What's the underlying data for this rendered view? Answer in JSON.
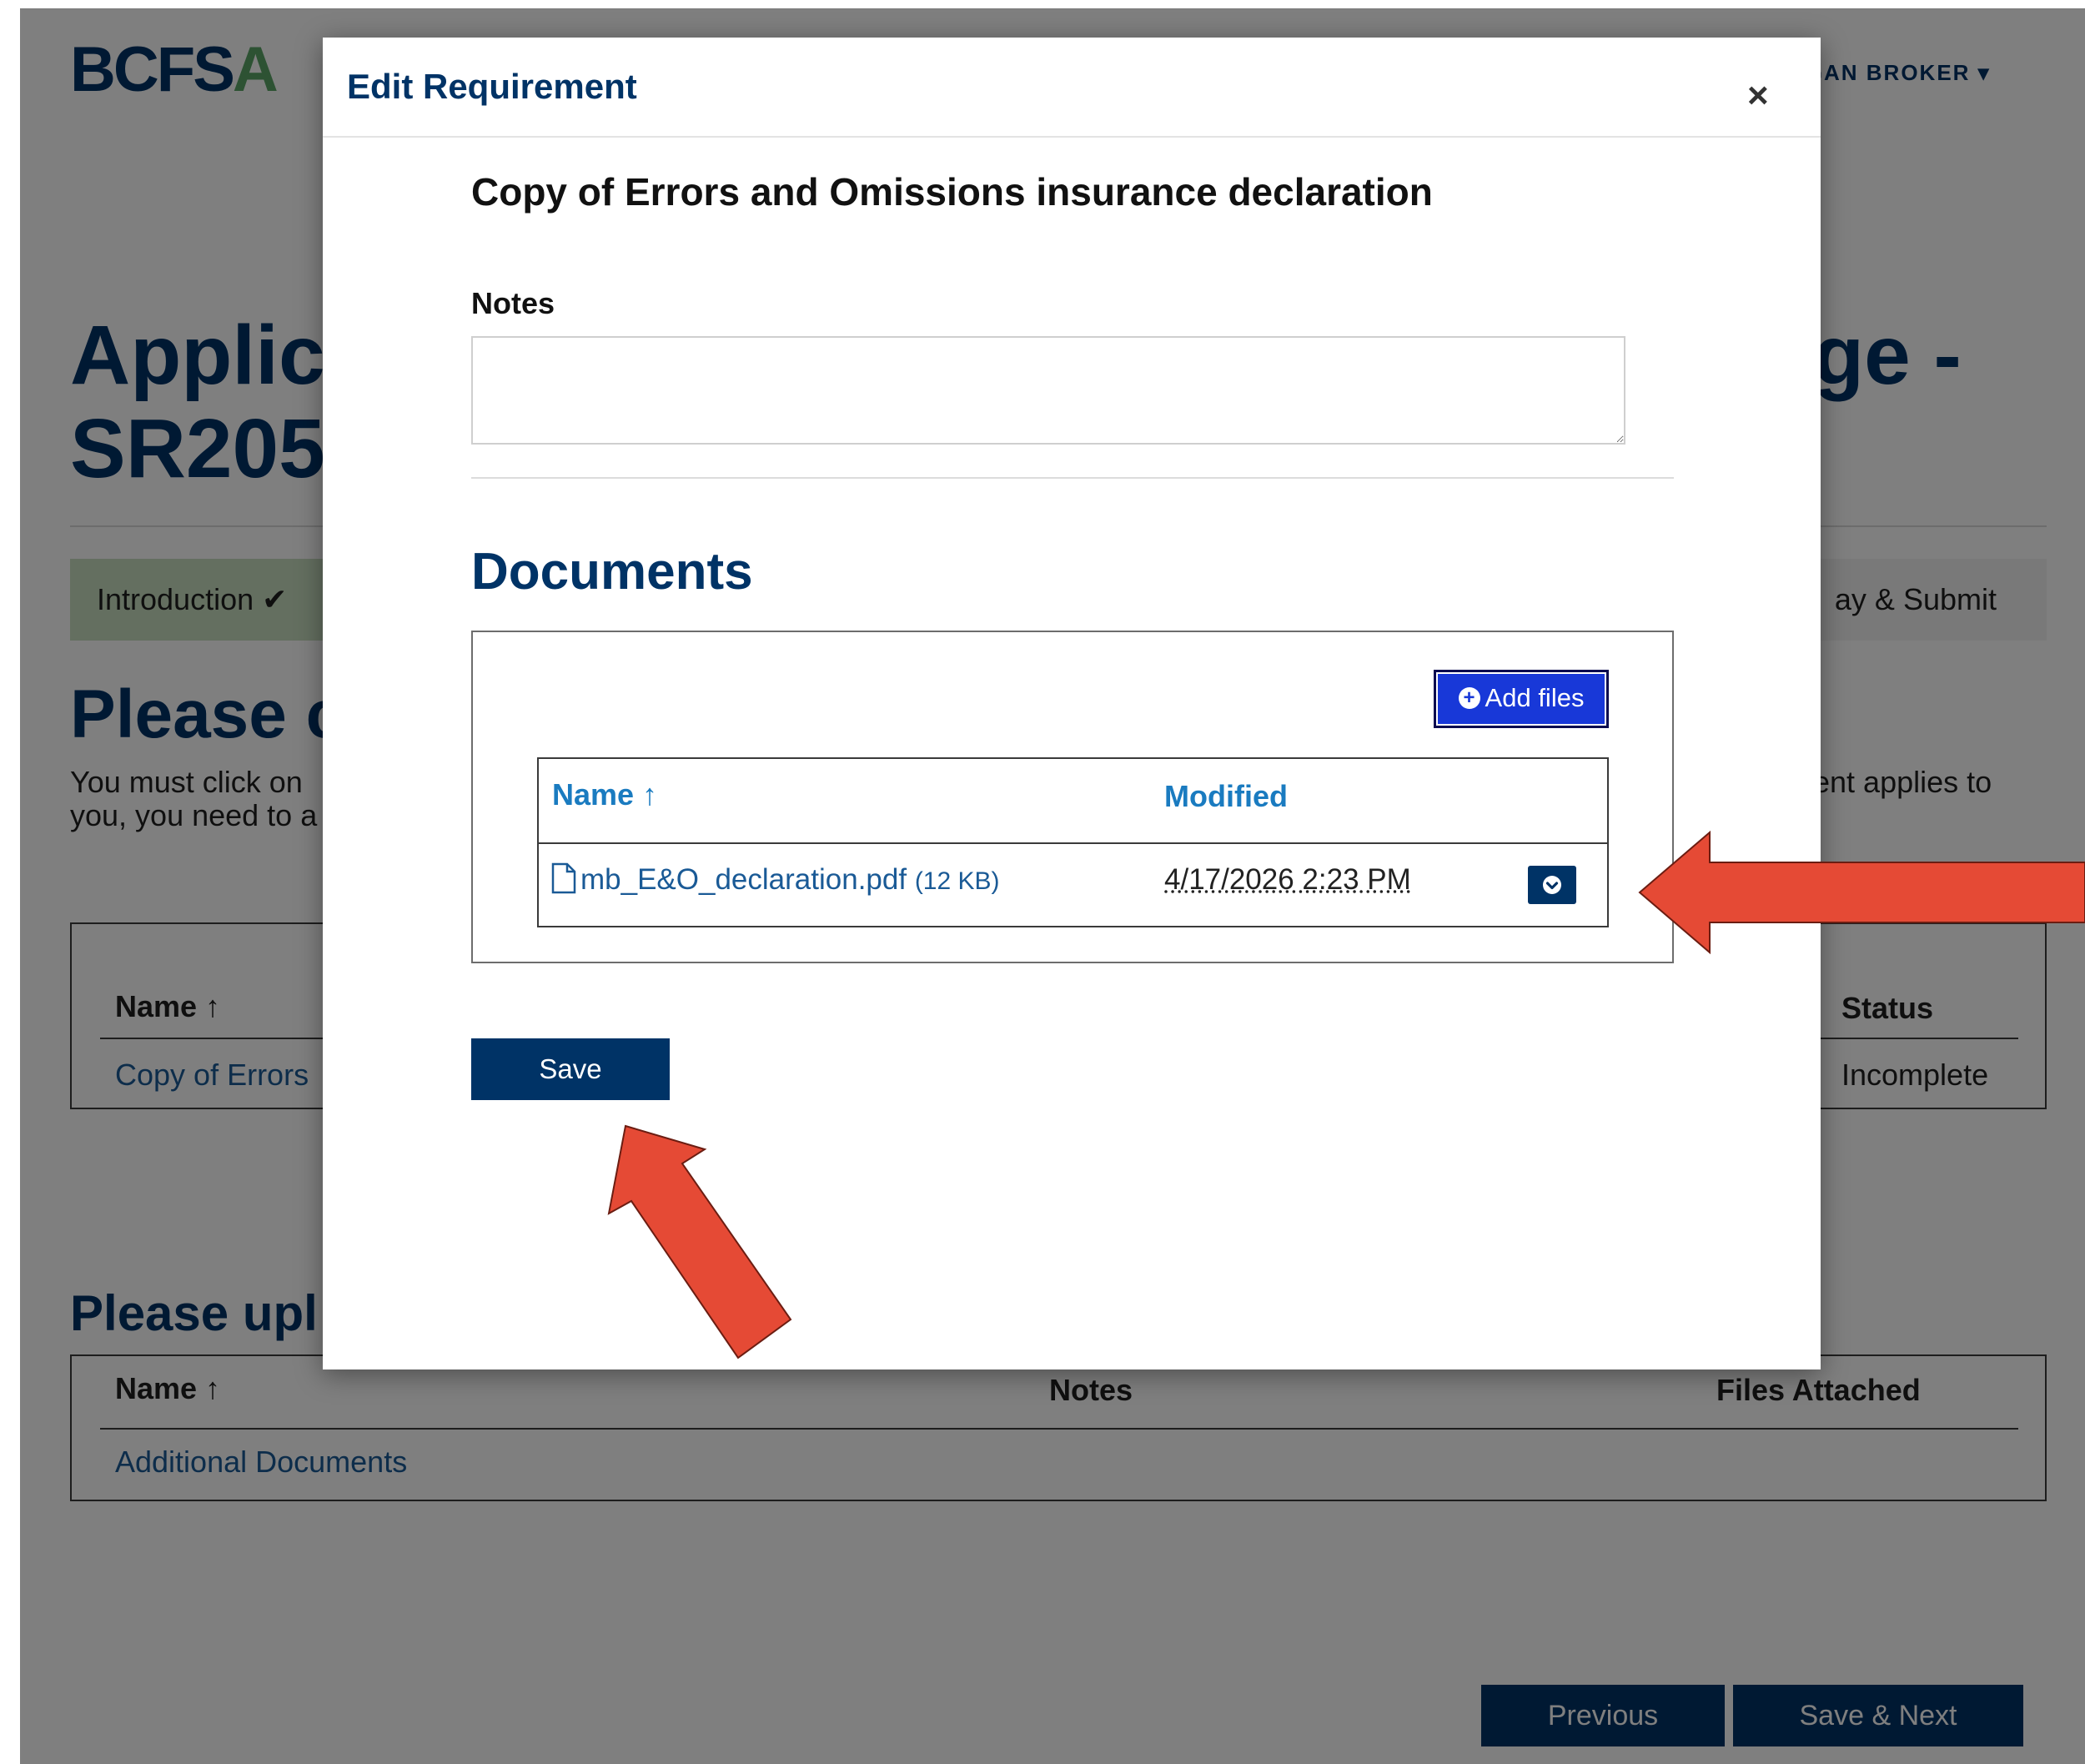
{
  "background": {
    "logo": {
      "main": "BCFS",
      "accent": "A"
    },
    "user_menu": "RGAN BROKER ▾",
    "page_title": {
      "line1": "Applic",
      "line1_tail": "ge -",
      "line2": "SR205"
    },
    "stepper": {
      "first": "Introduction ✔",
      "last": "ay & Submit"
    },
    "section1": {
      "heading": "Please c",
      "text_line1": "You must click on",
      "text_line1_tail": "ent applies to",
      "text_line2": "you, you need to a",
      "table": {
        "col_name": "Name",
        "col_status": "Status",
        "row_name": "Copy of Errors",
        "row_status": "Incomplete"
      }
    },
    "section2": {
      "heading": "Please upl",
      "table": {
        "col_name": "Name",
        "col_notes": "Notes",
        "col_files": "Files Attached",
        "row_name": "Additional Documents"
      }
    },
    "buttons": {
      "previous": "Previous",
      "save_next": "Save & Next"
    }
  },
  "modal": {
    "title": "Edit Requirement",
    "close": "×",
    "requirement_title": "Copy of Errors and Omissions insurance declaration",
    "notes_label": "Notes",
    "notes_value": "",
    "documents_heading": "Documents",
    "add_files_label": "Add files",
    "files_table": {
      "col_name": "Name",
      "col_modified": "Modified",
      "rows": [
        {
          "name": "mb_E&O_declaration.pdf",
          "size": "(12 KB)",
          "modified": "4/17/2026 2:23 PM"
        }
      ]
    },
    "save_label": "Save"
  },
  "colors": {
    "primary": "#003366",
    "link": "#1a5a96",
    "add_files": "#1838d8",
    "annotation_arrow": "#e54a35"
  }
}
